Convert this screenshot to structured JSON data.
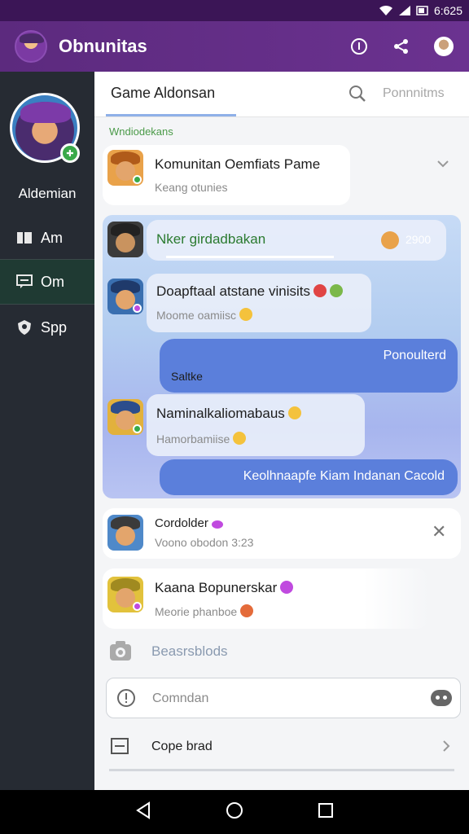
{
  "status_bar": {
    "time": "6:625"
  },
  "app_bar": {
    "title": "Obnunitas"
  },
  "sidebar": {
    "user_name": "Aldemian",
    "items": [
      {
        "label": "Am",
        "icon": "book-icon"
      },
      {
        "label": "Om",
        "icon": "chat-icon"
      },
      {
        "label": "Spp",
        "icon": "shield-icon"
      }
    ]
  },
  "topbar": {
    "tab_label": "Game Aldonsan",
    "search_placeholder": "Ponnnitms"
  },
  "section_label": "Wndiodekans",
  "channel": {
    "title": "Komunitan Oemfiats Pame",
    "subtitle": "Keang otunies"
  },
  "chat": {
    "header_name": "Nker girdadbakan",
    "header_count": "2900",
    "message1_title": "Doapftaal atstane vinisits",
    "message1_sub": "Moome oamiisc",
    "reply1_top": "Ponoulterd",
    "reply1_bottom": "Saltke",
    "message2_title": "Naminalkaliomabaus",
    "message2_sub": "Hamorbamiise",
    "reply2": "Keolhnaapfe Kiam Indanan Cacold"
  },
  "notification": {
    "title": "Cordolder",
    "subtitle": "Voono obodon 3:23"
  },
  "contact": {
    "title": "Kaana Bopunerskar",
    "subtitle": "Meorie phanboe"
  },
  "screenshots_label": "Beasrsblods",
  "command_input": {
    "placeholder": "Comndan"
  },
  "bottom_item": {
    "label": "Cope brad"
  },
  "colors": {
    "brand_purple": "#5c2a7e",
    "online_green": "#3aa94a",
    "bubble_blue": "#5b7fdb"
  }
}
